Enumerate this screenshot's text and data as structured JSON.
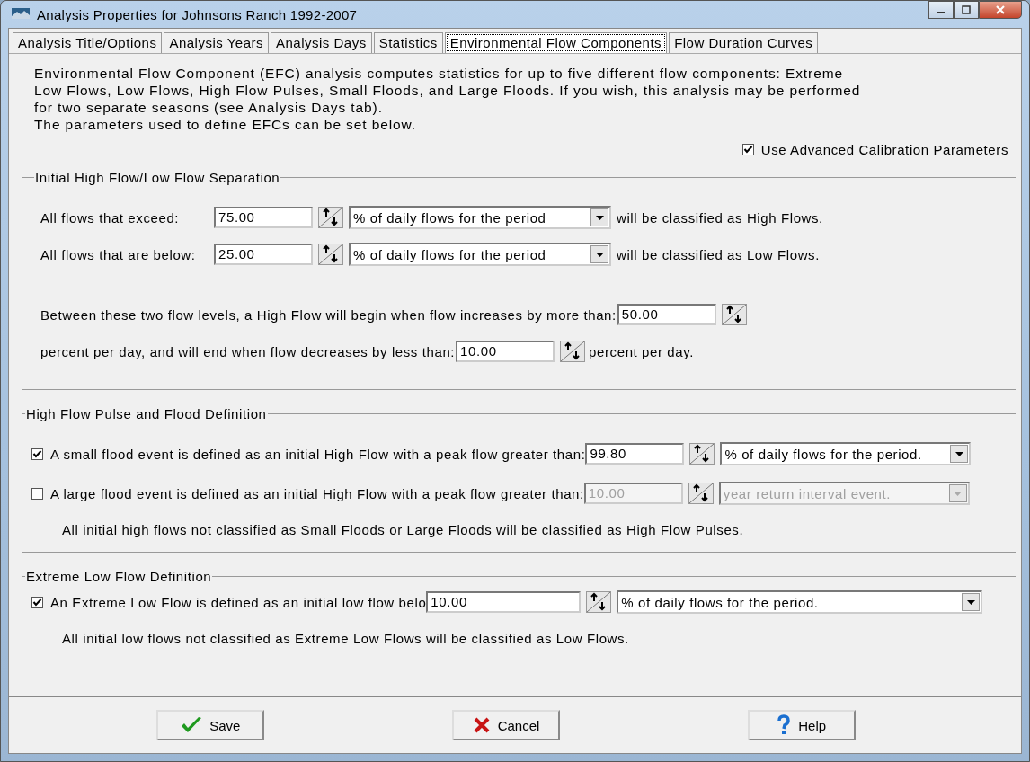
{
  "window": {
    "title": "Analysis Properties for Johnsons Ranch 1992-2007"
  },
  "tabs": [
    {
      "label": "Analysis Title/Options",
      "selected": false
    },
    {
      "label": "Analysis Years",
      "selected": false
    },
    {
      "label": "Analysis Days",
      "selected": false
    },
    {
      "label": "Statistics",
      "selected": false
    },
    {
      "label": "Environmental Flow Components",
      "selected": true
    },
    {
      "label": "Flow Duration Curves",
      "selected": false
    }
  ],
  "intro": [
    "Environmental Flow Component (EFC) analysis computes statistics for up to five different flow components: Extreme",
    "Low Flows, Low Flows, High Flow Pulses, Small Floods, and Large Floods.  If you wish, this analysis may be performed",
    "for two separate seasons (see Analysis Days tab).",
    "The parameters used to define EFCs can be set below."
  ],
  "advanced": {
    "label": "Use Advanced Calibration Parameters",
    "checked": true
  },
  "separation": {
    "title": "Initial High Flow/Low Flow Separation",
    "rows": [
      {
        "label": "All flows that exceed:",
        "value": "75.00",
        "unit": "% of daily flows for the period",
        "suffix": "will be classified as High Flows."
      },
      {
        "label": "All flows that are below:",
        "value": "25.00",
        "unit": "% of daily flows for the period",
        "suffix": "will be classified as Low Flows."
      }
    ],
    "rate_rows": [
      {
        "label": "Between these two flow levels, a High Flow will begin when flow increases by more than:",
        "value": "50.00"
      },
      {
        "label": "percent per day, and will end when flow decreases by less than:",
        "value": "10.00",
        "suffix": "percent per day."
      }
    ]
  },
  "flood": {
    "title": "High Flow Pulse and Flood Definition",
    "rows": [
      {
        "label": "A small flood event is defined as an initial High Flow with a peak flow greater than:",
        "checked": true,
        "disabled": false,
        "value": "99.80",
        "unit": "% of daily flows for the period."
      },
      {
        "label": "A large flood event is defined as an initial High Flow with a peak flow greater than:",
        "checked": false,
        "disabled": true,
        "value": "10.00",
        "unit": "year return interval event."
      }
    ],
    "note": "All initial high flows not classified as Small Floods or Large Floods will be classified as High Flow Pulses."
  },
  "extreme": {
    "title": "Extreme Low Flow Definition",
    "row": {
      "label": "An Extreme Low Flow is defined as an initial low flow belo",
      "checked": true,
      "value": "10.00",
      "unit": "% of daily flows for the period."
    },
    "note": "All initial low flows not classified as Extreme Low Flows will be classified as Low Flows."
  },
  "buttons": [
    {
      "label": "Save",
      "kind": "check"
    },
    {
      "label": "Cancel",
      "kind": "cross"
    },
    {
      "label": "Help",
      "kind": "question"
    }
  ]
}
